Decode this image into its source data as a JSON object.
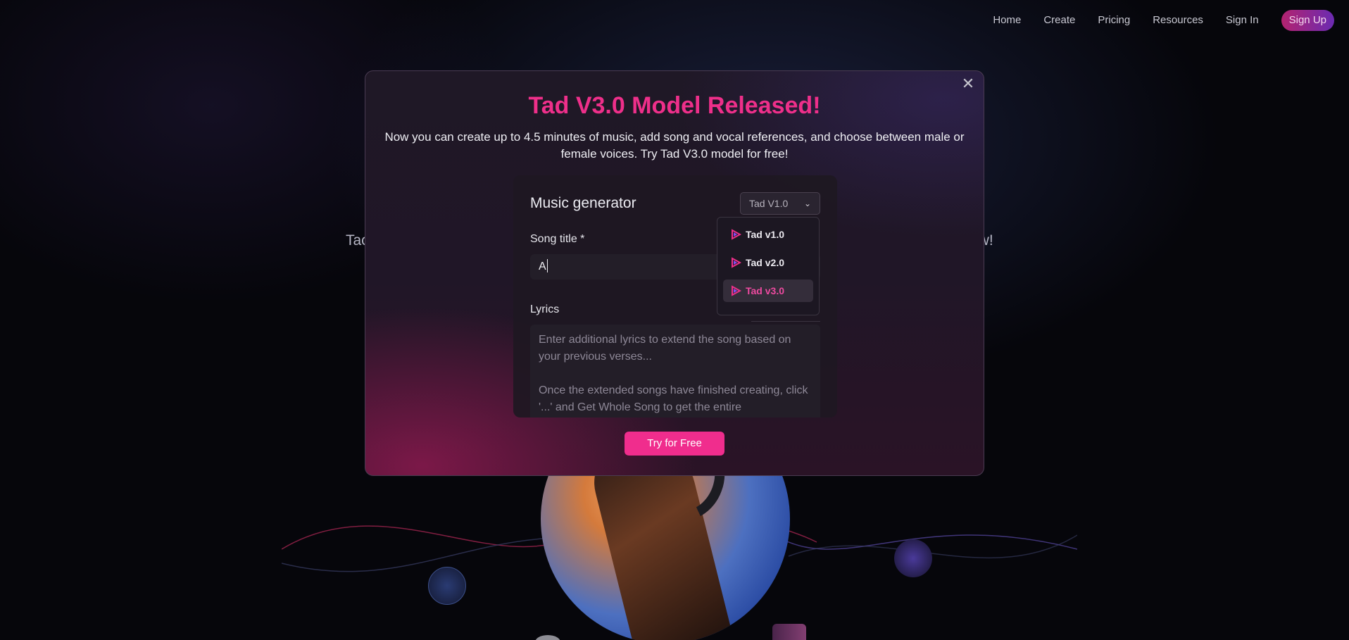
{
  "nav": {
    "items": [
      "Home",
      "Create",
      "Pricing",
      "Resources",
      "Sign In"
    ],
    "signup": "Sign Up"
  },
  "hero": {
    "left_fragment": "Tac",
    "right_fragment": "ow!"
  },
  "modal": {
    "close": "✕",
    "title": "Tad V3.0 Model Released!",
    "description": "Now you can create up to 4.5 minutes of music, add song and vocal references, and choose between male or female voices. Try Tad V3.0 model for free!",
    "card": {
      "title": "Music generator",
      "model_select": "Tad V1.0",
      "song_title_label": "Song title *",
      "song_title_value": "A",
      "lyrics_label": "Lyrics",
      "lyrics_placeholder_1": "Enter additional lyrics to extend the song based on your previous verses...",
      "lyrics_placeholder_2": "Once the extended songs have finished creating, click '...' and Get Whole Song to get the entire"
    },
    "cta": "Try for Free"
  },
  "dropdown": {
    "options": [
      "Tad v1.0",
      "Tad v2.0",
      "Tad v3.0"
    ],
    "selected": "Tad v3.0",
    "icon": "play-logo-icon",
    "accent": "#ee2f8a"
  }
}
